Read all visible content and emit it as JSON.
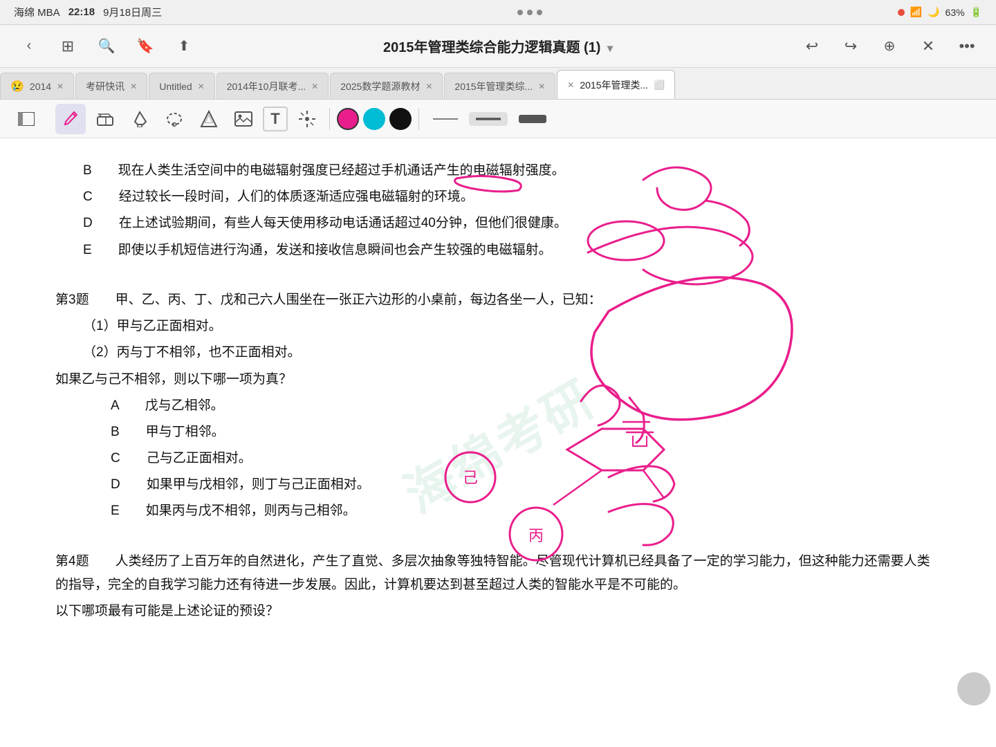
{
  "statusBar": {
    "carrier": "海绵 MBA",
    "time": "22:18",
    "date": "9月18日周三",
    "dots": "...",
    "battery": "63%"
  },
  "titleBar": {
    "title": "2015年管理类综合能力逻辑真题 (1)",
    "dropdown": "▼",
    "backBtn": "‹",
    "forwardBtn": "›"
  },
  "tabs": [
    {
      "id": "tab1",
      "label": "2014😢",
      "active": false,
      "closable": true
    },
    {
      "id": "tab2",
      "label": "考研快讯",
      "active": false,
      "closable": true
    },
    {
      "id": "tab3",
      "label": "Untitled",
      "active": false,
      "closable": true
    },
    {
      "id": "tab4",
      "label": "2014年10月联考...",
      "active": false,
      "closable": true
    },
    {
      "id": "tab5",
      "label": "2025数学题源教材",
      "active": false,
      "closable": true
    },
    {
      "id": "tab6",
      "label": "2015年管理类综...",
      "active": false,
      "closable": true
    },
    {
      "id": "tab7",
      "label": "2015年管理类...",
      "active": true,
      "closable": true
    }
  ],
  "toolbar": {
    "tools": [
      {
        "id": "sidebar",
        "icon": "⬛",
        "label": "sidebar-toggle"
      },
      {
        "id": "pen",
        "icon": "✏️",
        "label": "pen-tool",
        "active": true
      },
      {
        "id": "eraser",
        "icon": "◻",
        "label": "eraser-tool"
      },
      {
        "id": "highlighter",
        "icon": "🖊",
        "label": "highlighter-tool"
      },
      {
        "id": "lasso",
        "icon": "⭕",
        "label": "lasso-tool"
      },
      {
        "id": "shape",
        "icon": "☆",
        "label": "shape-tool"
      },
      {
        "id": "image",
        "icon": "🖼",
        "label": "image-tool"
      },
      {
        "id": "text",
        "icon": "T",
        "label": "text-tool"
      },
      {
        "id": "laser",
        "icon": "✦",
        "label": "laser-tool"
      }
    ],
    "colors": [
      {
        "id": "pink",
        "hex": "#e91e8c",
        "selected": true
      },
      {
        "id": "cyan",
        "hex": "#00bcd4",
        "selected": false
      },
      {
        "id": "black",
        "hex": "#111111",
        "selected": false
      }
    ],
    "lineWeights": [
      {
        "id": "thin",
        "label": "thin-line"
      },
      {
        "id": "medium",
        "label": "medium-line",
        "selected": true
      },
      {
        "id": "thick",
        "label": "thick-line"
      }
    ]
  },
  "document": {
    "watermark": "海绵考研",
    "lines": [
      {
        "id": "line-B",
        "text": "B   现在人类生活空间中的电磁辐射强度已经超过手机通话产生的电磁辐射强度。",
        "indent": 1
      },
      {
        "id": "line-C",
        "text": "C   经过较长一段时间，人们的体质逐渐适应强电磁辐射的环境。",
        "indent": 1
      },
      {
        "id": "line-D",
        "text": "D   在上述试验期间，有些人每天使用移动电话通话超过40分钟，但他们很健康。",
        "indent": 1
      },
      {
        "id": "line-E",
        "text": "E   即使以手机短信进行沟通，发送和接收信息瞬间也会产生较强的电磁辐射。",
        "indent": 1
      },
      {
        "id": "q3-header",
        "text": "第3题   甲、乙、丙、丁、戊和己六人围坐在一张正六边形的小桌前，每边各坐一人，已知：",
        "indent": 0,
        "isHeader": true
      },
      {
        "id": "q3-cond1",
        "text": "（1）甲与乙正面相对。",
        "indent": 1
      },
      {
        "id": "q3-cond2",
        "text": "（2）丙与丁不相邻，也不正面相对。",
        "indent": 1
      },
      {
        "id": "q3-question",
        "text": "如果乙与己不相邻，则以下哪一项为真？",
        "indent": 0
      },
      {
        "id": "q3-A",
        "text": "A    戊与乙相邻。",
        "indent": 2
      },
      {
        "id": "q3-B",
        "text": "B    甲与丁相邻。",
        "indent": 2
      },
      {
        "id": "q3-C",
        "text": "C    己与乙正面相对。",
        "indent": 2
      },
      {
        "id": "q3-D",
        "text": "D    如果甲与戊相邻，则丁与己正面相对。",
        "indent": 2
      },
      {
        "id": "q3-E",
        "text": "E    如果丙与戊不相邻，则丙与己相邻。",
        "indent": 2
      },
      {
        "id": "q4-header",
        "text": "第4题   人类经历了上百万年的自然进化，产生了直觉、多层次抽象等独特智能。尽管现代计算机已经具备了一定的学习能力，但这种能力还需要人类的指导，完全的自我学习能力还有待进一步发展。因此，计算机要达到甚至超过人类的智能水平是不可能的。",
        "indent": 0,
        "isHeader": true
      },
      {
        "id": "q4-question",
        "text": "以下哪项最有可能是上述论证的预设？",
        "indent": 0
      }
    ]
  }
}
